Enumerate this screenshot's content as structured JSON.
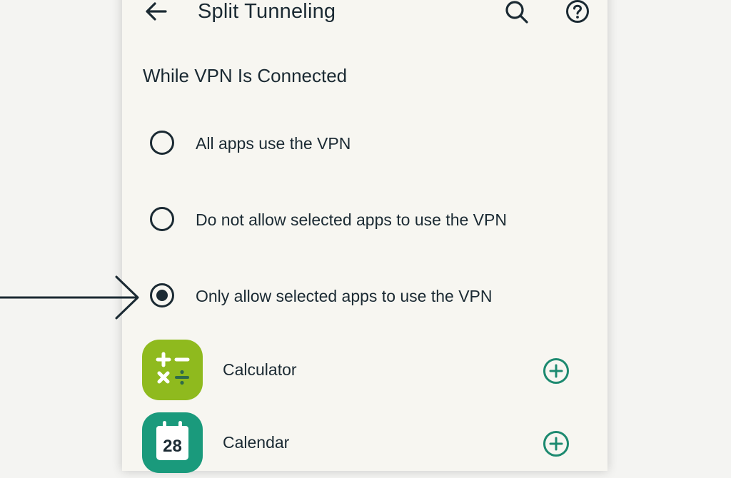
{
  "appbar": {
    "title": "Split Tunneling",
    "back_icon": "arrow-left-icon",
    "search_icon": "search-icon",
    "help_icon": "help-circle-icon"
  },
  "section": {
    "title": "While VPN Is Connected"
  },
  "options": [
    {
      "label": "All apps use the VPN",
      "selected": false
    },
    {
      "label": "Do not allow selected apps to use the VPN",
      "selected": false
    },
    {
      "label": "Only allow selected apps to use the VPN",
      "selected": true
    }
  ],
  "apps": [
    {
      "name": "Calculator",
      "icon": "calculator-icon",
      "color": "#8fba1e",
      "action_icon": "add-circle-icon"
    },
    {
      "name": "Calendar",
      "icon": "calendar-icon",
      "color": "#1a9a7c",
      "icon_text": "28",
      "action_icon": "add-circle-icon"
    }
  ],
  "colors": {
    "accent": "#1d8a70",
    "text": "#1b2a33",
    "background": "#f7f6f1"
  }
}
